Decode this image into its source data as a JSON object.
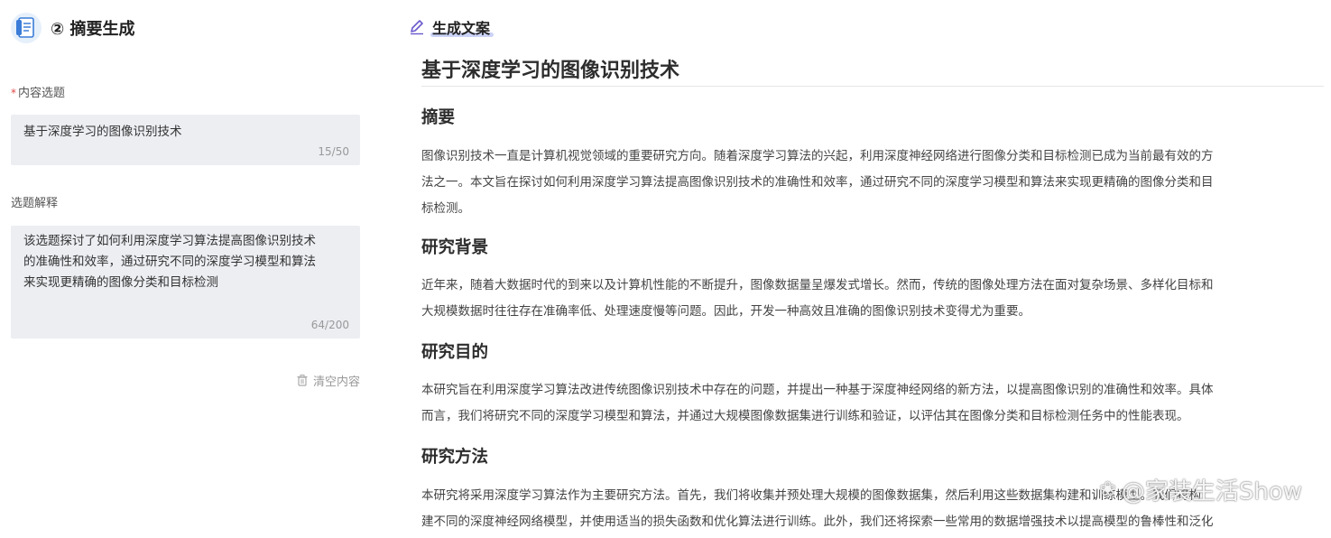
{
  "left_panel": {
    "step_title": "② 摘要生成",
    "topic": {
      "label": "内容选题",
      "value": "基于深度学习的图像识别技术",
      "counter": "15/50"
    },
    "explanation": {
      "label": "选题解释",
      "lines": [
        "该选题探讨了如何利用深度学习算法提高图像识别技术",
        "的准确性和效率，通过研究不同的深度学习模型和算法",
        "来实现更精确的图像分类和目标检测"
      ],
      "counter": "64/200"
    },
    "clear_label": "清空内容"
  },
  "right_panel": {
    "header_label": "生成文案",
    "doc_title": "基于深度学习的图像识别技术",
    "sections": [
      {
        "heading": "摘要",
        "lines": [
          "图像识别技术一直是计算机视觉领域的重要研究方向。随着深度学习算法的兴起，利用深度神经网络进行图像分类和目标检测已成为当前最有效的方",
          "法之一。本文旨在探讨如何利用深度学习算法提高图像识别技术的准确性和效率，通过研究不同的深度学习模型和算法来实现更精确的图像分类和目",
          "标检测。"
        ]
      },
      {
        "heading": "研究背景",
        "lines": [
          "近年来，随着大数据时代的到来以及计算机性能的不断提升，图像数据量呈爆发式增长。然而，传统的图像处理方法在面对复杂场景、多样化目标和",
          "大规模数据时往往存在准确率低、处理速度慢等问题。因此，开发一种高效且准确的图像识别技术变得尤为重要。"
        ]
      },
      {
        "heading": "研究目的",
        "lines": [
          "本研究旨在利用深度学习算法改进传统图像识别技术中存在的问题，并提出一种基于深度神经网络的新方法，以提高图像识别的准确性和效率。具体",
          "而言，我们将研究不同的深度学习模型和算法，并通过大规模图像数据集进行训练和验证，以评估其在图像分类和目标检测任务中的性能表现。"
        ]
      },
      {
        "heading": "研究方法",
        "lines": [
          "本研究将采用深度学习算法作为主要研究方法。首先，我们将收集并预处理大规模的图像数据集，然后利用这些数据集构建和训练模型。我们将构",
          "建不同的深度神经网络模型，并使用适当的损失函数和优化算法进行训练。此外，我们还将探索一些常用的数据增强技术以提高模型的鲁棒性和泛化"
        ]
      }
    ]
  },
  "watermark": "@家装生活Show",
  "colors": {
    "accent": "#6a5acd",
    "field_bg": "#eceef2",
    "required": "#e04848"
  }
}
